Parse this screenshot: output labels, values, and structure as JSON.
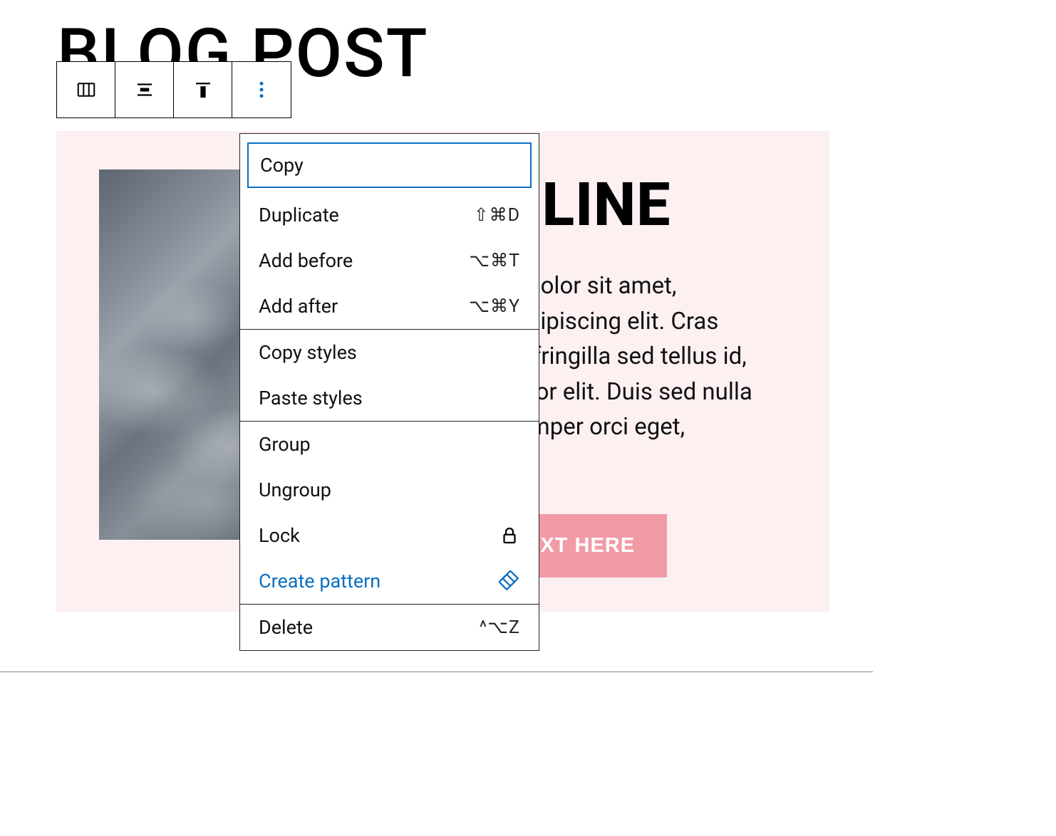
{
  "page_title": "BLOG POST",
  "content": {
    "headline": "HEADLINE",
    "body": "Lorem ipsum dolor sit amet, consectetur adipiscing elit. Cras mattis metus, fringilla sed tellus id, sodales porttitor elit. Duis sed nulla consequat, semper orci eget, accumsan ex.",
    "cta": "BUTTON TEXT HERE"
  },
  "menu": {
    "copy": "Copy",
    "duplicate": {
      "label": "Duplicate",
      "shortcut": "⇧⌘D"
    },
    "add_before": {
      "label": "Add before",
      "shortcut": "⌥⌘T"
    },
    "add_after": {
      "label": "Add after",
      "shortcut": "⌥⌘Y"
    },
    "copy_styles": "Copy styles",
    "paste_styles": "Paste styles",
    "group": "Group",
    "ungroup": "Ungroup",
    "lock": "Lock",
    "create_pattern": "Create pattern",
    "delete": {
      "label": "Delete",
      "shortcut": "^⌥Z"
    }
  }
}
